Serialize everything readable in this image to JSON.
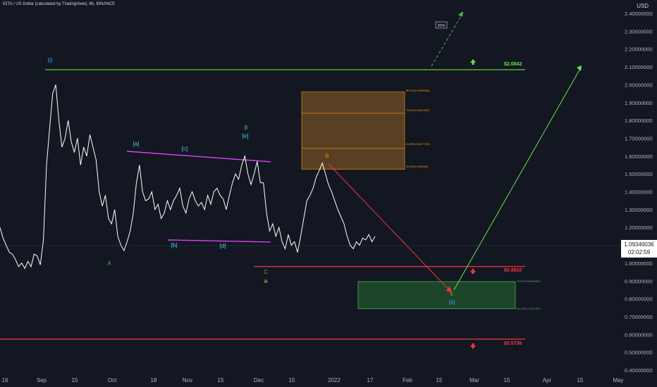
{
  "header": {
    "symbol": "IOTA / US Dollar (calculated by TradingView), 8h, BINANCE",
    "currency": "USD"
  },
  "price_box": {
    "price": "1.09346036",
    "countdown": "02:02:59"
  },
  "colors": {
    "background": "#131722",
    "candle": "#ffffff",
    "grid_text": "#b2b5be",
    "green": "#4caf50",
    "bright_green": "#66e34b",
    "red": "#f23645",
    "magenta": "#e040fb",
    "orange": "#ff9800",
    "cyan": "#4dd0e1",
    "blue": "#42a5f5",
    "yellow": "#ffc107"
  },
  "chart_data": {
    "type": "line",
    "title": "",
    "x_ticks": [
      "16",
      "Sep",
      "15",
      "Oct",
      "18",
      "Nov",
      "15",
      "Dec",
      "15",
      "2022",
      "17",
      "Feb",
      "15",
      "Mar",
      "15",
      "Apr",
      "15",
      "May"
    ],
    "y_ticks": [
      "2.40000000",
      "2.30000000",
      "2.20000000",
      "2.10000000",
      "2.00000000",
      "1.90000000",
      "1.80000000",
      "1.70000000",
      "1.60000000",
      "1.50000000",
      "1.40000000",
      "1.30000000",
      "1.20000000",
      "1.10000000",
      "1.00000000",
      "0.90000000",
      "0.80000000",
      "0.70000000",
      "0.60000000",
      "0.50000000",
      "0.40000000"
    ],
    "ylim": [
      0.38,
      2.44
    ],
    "series": [
      {
        "values": [
          1.2,
          1.14,
          1.1,
          1.06,
          1.05,
          1.02,
          0.98,
          1.0,
          0.97,
          1.01,
          0.98,
          1.05,
          1.04,
          0.99,
          1.13,
          1.55,
          1.75,
          1.95,
          2.0,
          1.8,
          1.65,
          1.7,
          1.8,
          1.68,
          1.62,
          1.7,
          1.55,
          1.65,
          1.6,
          1.72,
          1.65,
          1.58,
          1.4,
          1.32,
          1.38,
          1.25,
          1.22,
          1.3,
          1.15,
          1.1,
          1.07,
          1.12,
          1.18,
          1.28,
          1.45,
          1.55,
          1.4,
          1.35,
          1.36,
          1.4,
          1.3,
          1.33,
          1.25,
          1.28,
          1.35,
          1.3,
          1.35,
          1.38,
          1.42,
          1.32,
          1.28,
          1.36,
          1.4,
          1.35,
          1.32,
          1.34,
          1.3,
          1.38,
          1.33,
          1.4,
          1.42,
          1.38,
          1.36,
          1.3,
          1.38,
          1.45,
          1.5,
          1.47,
          1.55,
          1.6,
          1.5,
          1.44,
          1.5,
          1.57,
          1.45,
          1.45,
          1.28,
          1.18,
          1.22,
          1.15,
          1.2,
          1.12,
          1.08,
          1.16,
          1.1,
          1.12,
          1.06,
          1.15,
          1.25,
          1.35,
          1.38,
          1.42,
          1.48,
          1.52,
          1.56,
          1.5,
          1.44,
          1.4,
          1.35,
          1.3,
          1.26,
          1.22,
          1.15,
          1.1,
          1.08,
          1.12,
          1.1,
          1.14,
          1.13,
          1.16,
          1.12,
          1.15
        ]
      }
    ],
    "levels": [
      {
        "label": "$2.0842",
        "value": 2.0842
      },
      {
        "label": "$0.9810",
        "value": 0.981
      },
      {
        "label": "$0.5736",
        "value": 0.5736
      }
    ],
    "fib_zone_upper": [
      "88.70%(1.95955840)",
      "78.60%(1.84011520)",
      "61.80%(1.64277760)",
      "50.00%(1.5260000)"
    ],
    "fib_zone_lower": [
      "78.60%(0.89606840)",
      "88.70%(0.74429780)"
    ],
    "wave_labels": [
      "(i)",
      "A",
      "[a]",
      "[b]",
      "[c]",
      "[d]",
      "B",
      "[e]",
      "C",
      "a",
      "b",
      "c",
      "(ii)"
    ],
    "annotations": {
      "percent": "30%"
    }
  }
}
